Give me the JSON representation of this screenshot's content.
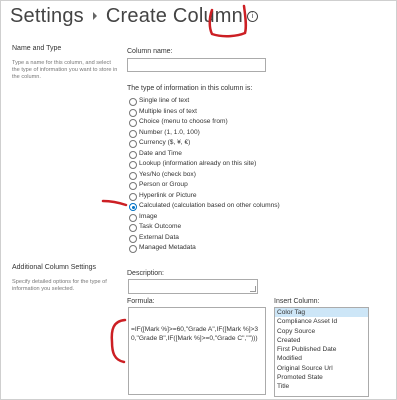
{
  "header": {
    "breadcrumb_root": "Settings",
    "page_title": "Create Column",
    "info_symbol": "i"
  },
  "name_and_type": {
    "heading": "Name and Type",
    "description": "Type a name for this column, and select the type of information you want to store in the column.",
    "column_name_label": "Column name:",
    "column_name_value": "",
    "type_prompt": "The type of information in this column is:",
    "types": [
      {
        "label": "Single line of text",
        "selected": false
      },
      {
        "label": "Multiple lines of text",
        "selected": false
      },
      {
        "label": "Choice (menu to choose from)",
        "selected": false
      },
      {
        "label": "Number (1, 1.0, 100)",
        "selected": false
      },
      {
        "label": "Currency ($, ¥, €)",
        "selected": false
      },
      {
        "label": "Date and Time",
        "selected": false
      },
      {
        "label": "Lookup (information already on this site)",
        "selected": false
      },
      {
        "label": "Yes/No (check box)",
        "selected": false
      },
      {
        "label": "Person or Group",
        "selected": false
      },
      {
        "label": "Hyperlink or Picture",
        "selected": false
      },
      {
        "label": "Calculated (calculation based on other columns)",
        "selected": true
      },
      {
        "label": "Image",
        "selected": false
      },
      {
        "label": "Task Outcome",
        "selected": false
      },
      {
        "label": "External Data",
        "selected": false
      },
      {
        "label": "Managed Metadata",
        "selected": false
      }
    ]
  },
  "additional_settings": {
    "heading": "Additional Column Settings",
    "description": "Specify detailed options for the type of information you selected.",
    "description_label": "Description:",
    "description_value": "",
    "formula_label": "Formula:",
    "formula_value": "=IF([Mark %]>=60,\"Grade A\",IF([Mark %]>30,\"Grade B\",IF([Mark %]>=0,\"Grade C\",\"\")))",
    "insert_column_label": "Insert Column:",
    "insert_columns": [
      {
        "label": "Color Tag",
        "selected": true
      },
      {
        "label": "Compliance Asset Id",
        "selected": false
      },
      {
        "label": "Copy Source",
        "selected": false
      },
      {
        "label": "Created",
        "selected": false
      },
      {
        "label": "First Published Date",
        "selected": false
      },
      {
        "label": "Modified",
        "selected": false
      },
      {
        "label": "Original Source Url",
        "selected": false
      },
      {
        "label": "Promoted State",
        "selected": false
      },
      {
        "label": "Title",
        "selected": false
      }
    ]
  },
  "colors": {
    "annotation_ink": "#cc1f24",
    "radio_selected": "#0072c6",
    "list_selection": "#cde6f7"
  }
}
